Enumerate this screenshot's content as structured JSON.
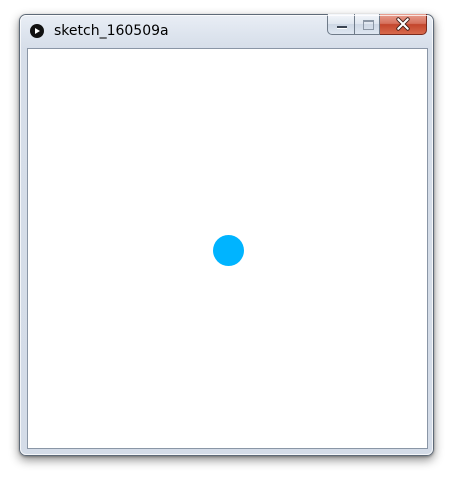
{
  "window": {
    "title": "sketch_160509a",
    "app_icon": "processing-play-icon"
  },
  "caption_buttons": {
    "minimize_icon": "minimize-icon",
    "maximize_icon": "maximize-icon",
    "close_icon": "close-icon"
  },
  "canvas": {
    "background": "#ffffff",
    "shape": "circle",
    "fill": "#00b4ff"
  }
}
